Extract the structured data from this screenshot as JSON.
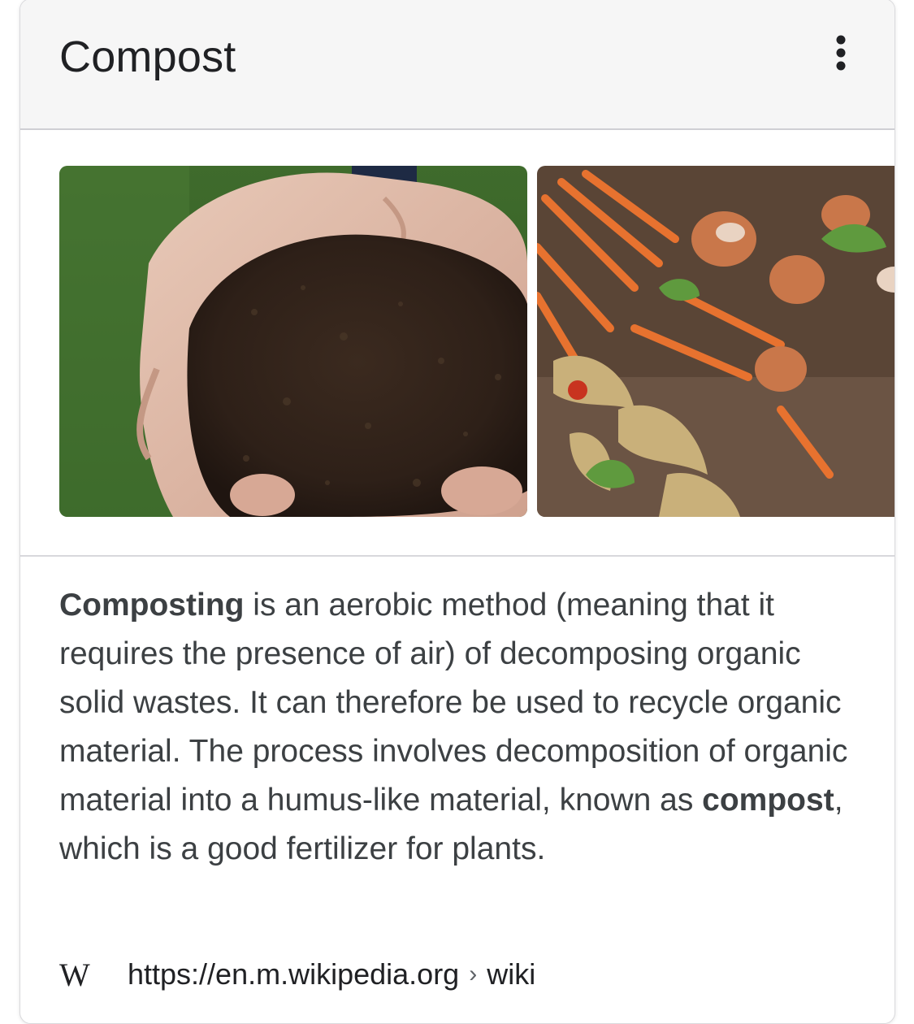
{
  "card": {
    "title": "Compost",
    "menu_icon": "more-vert-icon"
  },
  "images": [
    {
      "description_icon": "compost-in-hands-image"
    },
    {
      "description_icon": "kitchen-scraps-image"
    }
  ],
  "description": {
    "term1": "Composting",
    "text1": " is an aerobic method (meaning that it requires the presence of air) of decomposing organic solid wastes. It can therefore be used to recycle organic material. The process involves decomposition of organic material into a humus-like material, known as ",
    "term2": "compost",
    "text2": ", which is a good fertilizer for plants."
  },
  "source": {
    "logo_text": "W",
    "url": "https://en.m.wikipedia.org",
    "separator": "›",
    "path": "wiki"
  }
}
